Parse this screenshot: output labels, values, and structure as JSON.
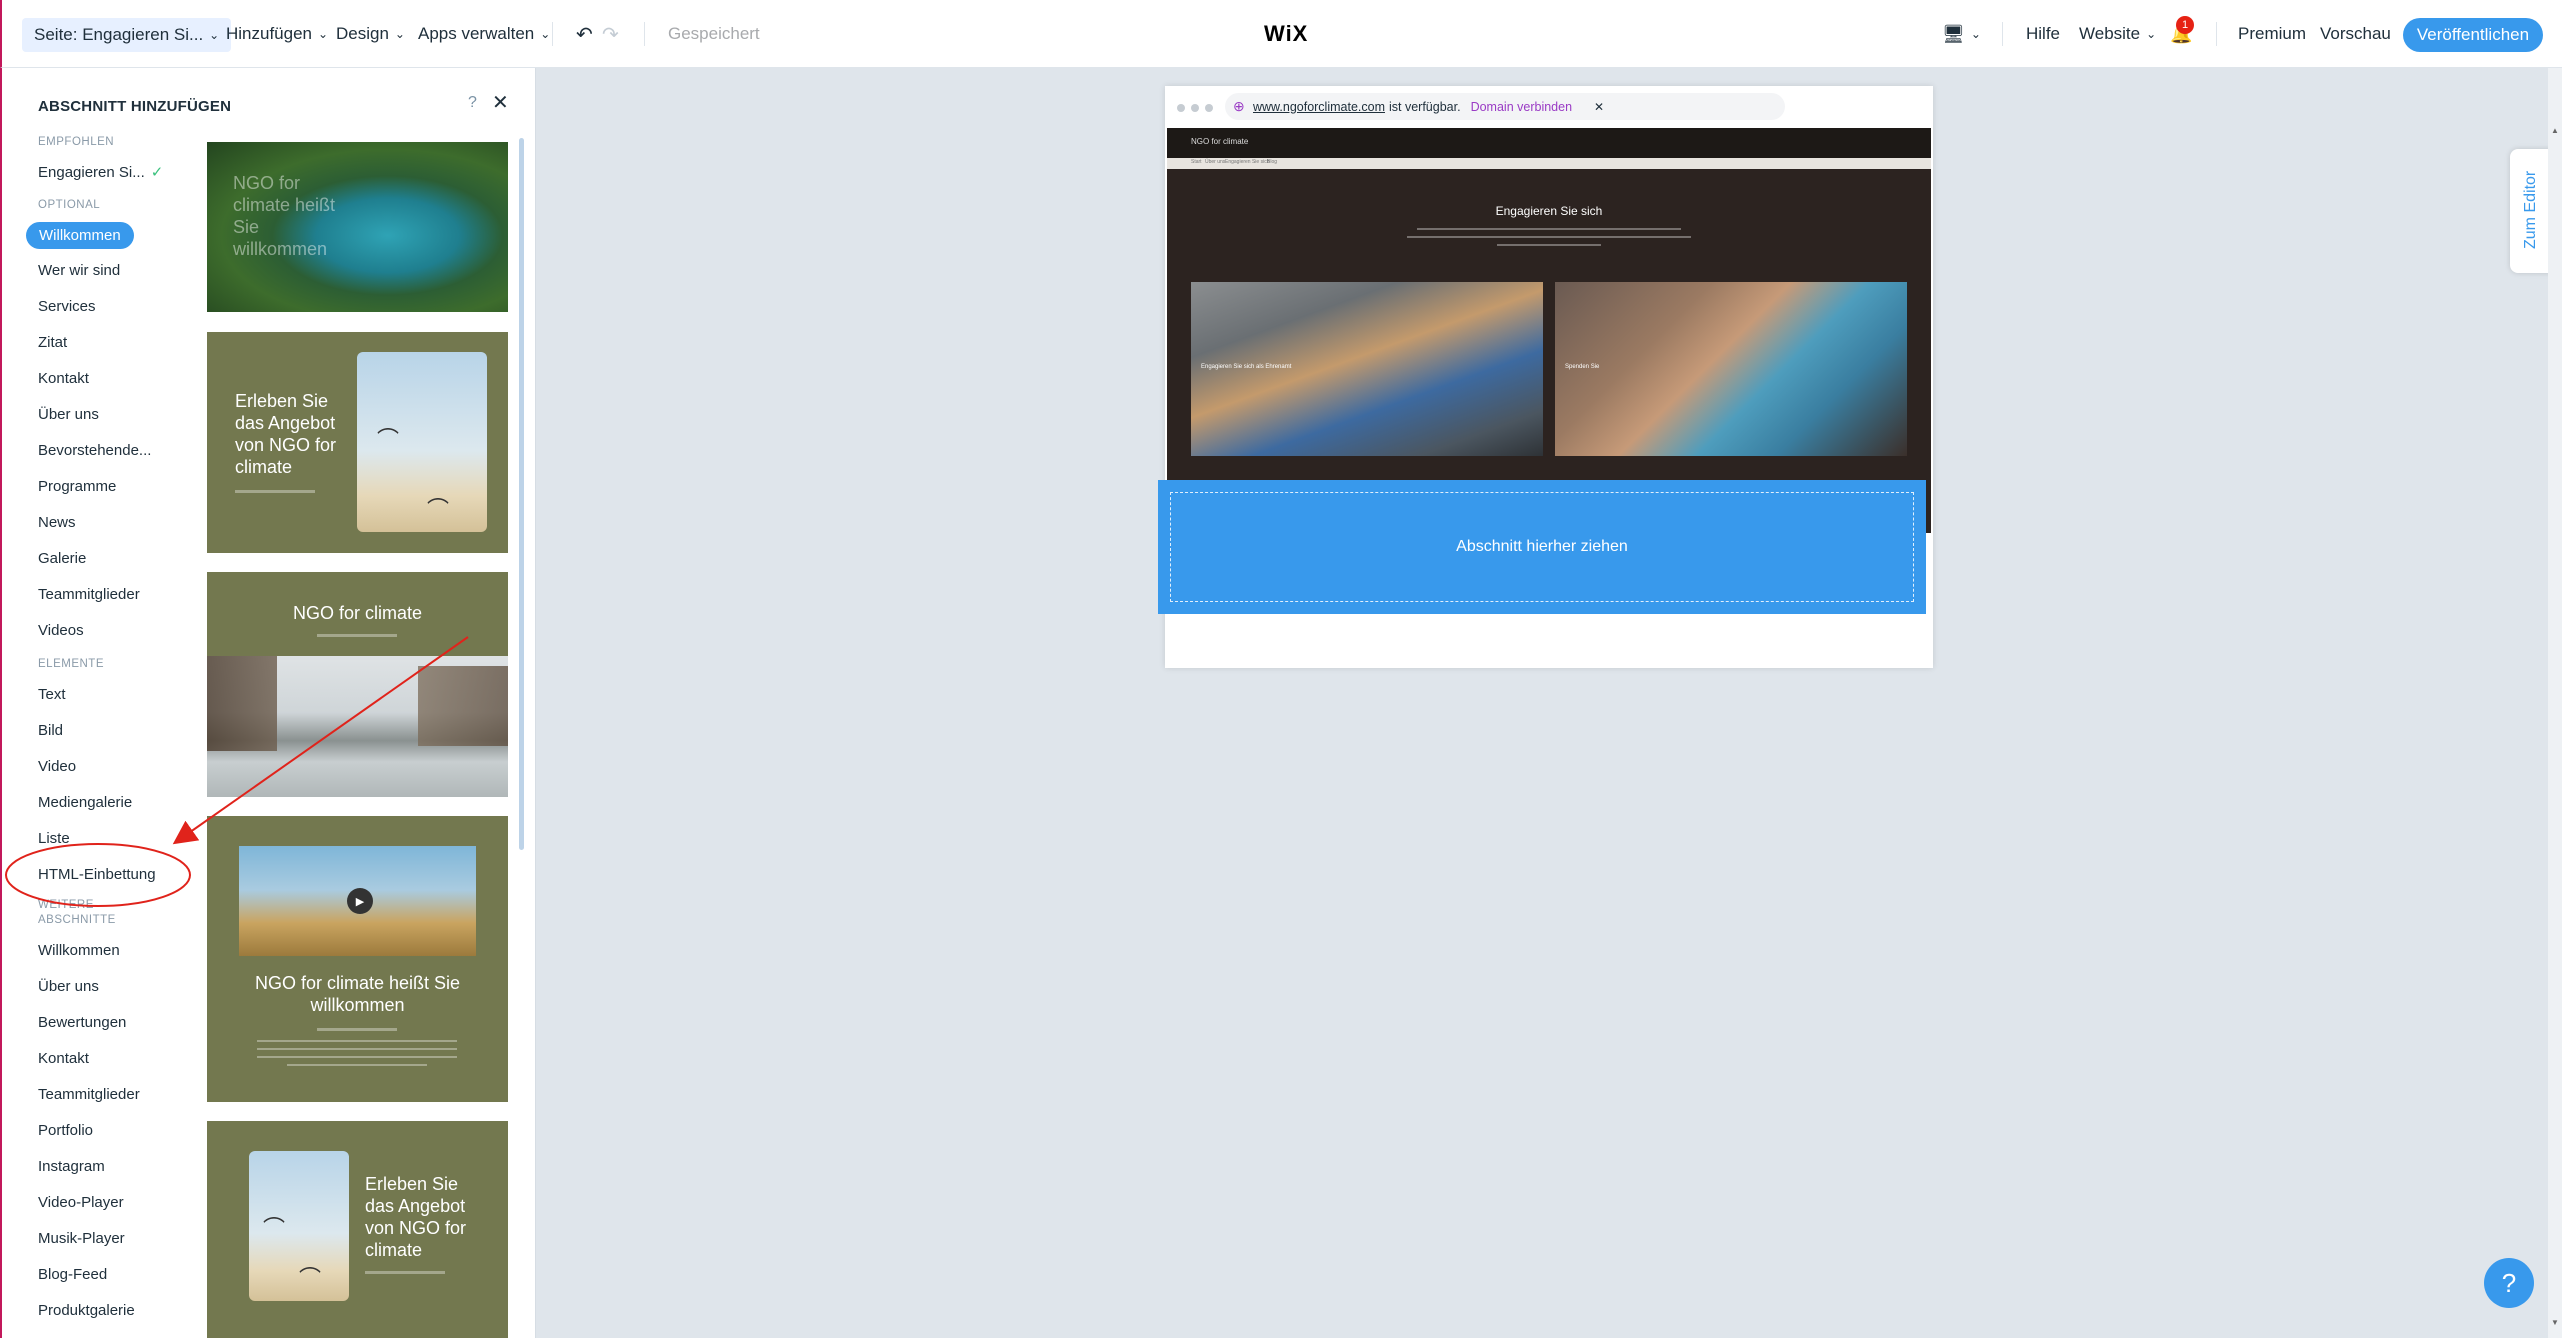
{
  "topbar": {
    "page_select": "Seite: Engagieren Si...",
    "menu_add": "Hinzufügen",
    "menu_design": "Design",
    "menu_apps": "Apps verwalten",
    "saved_status": "Gespeichert",
    "logo": "WiX",
    "help": "Hilfe",
    "website": "Website",
    "notifications_count": "1",
    "premium": "Premium",
    "preview": "Vorschau",
    "publish": "Veröffentlichen"
  },
  "panel": {
    "title": "ABSCHNITT HINZUFÜGEN",
    "help": "?",
    "close": "✕",
    "heading_recommended": "EMPFOHLEN",
    "recommended_item": "Engagieren Si...",
    "heading_optional": "OPTIONAL",
    "optional_items": [
      "Willkommen",
      "Wer wir sind",
      "Services",
      "Zitat",
      "Kontakt",
      "Über uns",
      "Bevorstehende...",
      "Programme",
      "News",
      "Galerie",
      "Teammitglieder",
      "Videos"
    ],
    "heading_elements": "ELEMENTE",
    "element_items": [
      "Text",
      "Bild",
      "Video",
      "Mediengalerie",
      "Liste",
      "HTML-Einbettung"
    ],
    "heading_more_1": "WEITERE",
    "heading_more_2": "ABSCHNITTE",
    "more_items": [
      "Willkommen",
      "Über uns",
      "Bewertungen",
      "Kontakt",
      "Teammitglieder",
      "Portfolio",
      "Instagram",
      "Video-Player",
      "Musik-Player",
      "Blog-Feed",
      "Produktgalerie"
    ],
    "thumbnails": {
      "t1_text": "NGO for climate heißt Sie willkommen",
      "t2_text": "Erleben Sie das Angebot von NGO for climate",
      "t3_text": "NGO for climate",
      "t4_text": "NGO for climate heißt Sie willkommen",
      "t5_text": "Erleben Sie das Angebot von NGO for climate"
    }
  },
  "preview": {
    "url": "www.ngoforclimate.com",
    "url_available": "ist verfügbar.",
    "connect_domain": "Domain verbinden",
    "url_close": "✕",
    "site_name": "NGO for climate",
    "nav_items": [
      "Start",
      "Über uns",
      "Engagieren Sie sich",
      "Blog"
    ],
    "section_heading": "Engagieren Sie sich",
    "card_left_caption": "Engagieren Sie sich als Ehrenamt",
    "card_right_caption": "Spenden Sie",
    "drop_zone_label": "Abschnitt hierher ziehen"
  },
  "right_rail": {
    "to_editor": "Zum Editor",
    "help_fab": "?"
  },
  "colors": {
    "accent": "#3899ec",
    "annotation_red": "#e0231b",
    "thumb_olive": "#73784f",
    "site_dark": "#2c2320"
  }
}
